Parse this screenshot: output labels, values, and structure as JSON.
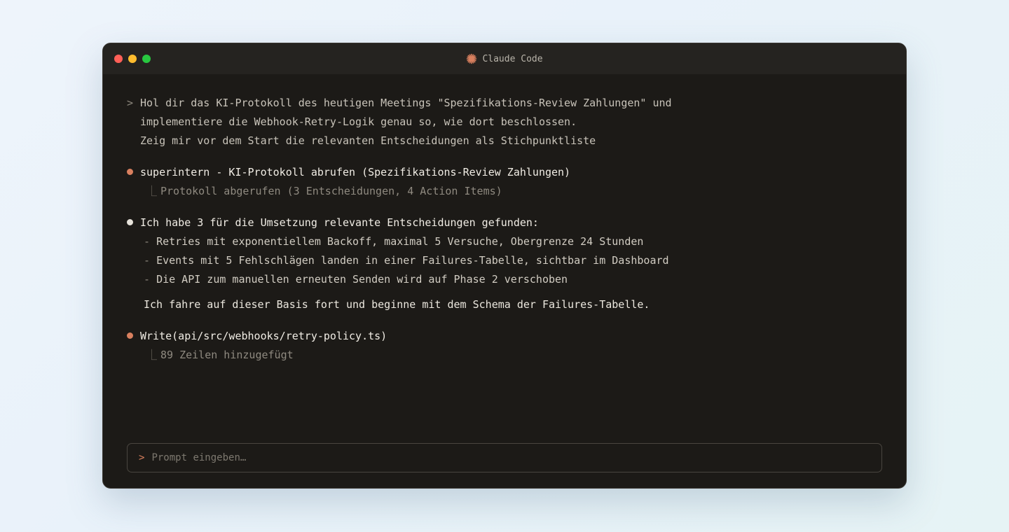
{
  "window": {
    "title": "Claude Code",
    "title_icon": "claude-asterisk-icon",
    "accent_color": "#d9805f"
  },
  "user_prompt": {
    "prefix": ">",
    "lines": [
      "Hol dir das KI-Protokoll des heutigen Meetings \"Spezifikations-Review Zahlungen\" und",
      "implementiere die Webhook-Retry-Logik genau so, wie dort beschlossen.",
      "Zeig mir vor dem Start die relevanten Entscheidungen als Stichpunktliste"
    ]
  },
  "tool_call_1": {
    "label": "superintern - KI-Protokoll abrufen (Spezifikations-Review Zahlungen)",
    "result": "Protokoll abgerufen (3 Entscheidungen, 4 Action Items)"
  },
  "assistant_message": {
    "intro": "Ich habe 3 für die Umsetzung relevante Entscheidungen gefunden:",
    "items": [
      "Retries mit exponentiellem Backoff, maximal 5 Versuche, Obergrenze 24 Stunden",
      "Events mit 5 Fehlschlägen landen in einer Failures-Tabelle, sichtbar im Dashboard",
      "Die API zum manuellen erneuten Senden wird auf Phase 2 verschoben"
    ],
    "summary": "Ich fahre auf dieser Basis fort und beginne mit dem Schema der Failures-Tabelle."
  },
  "tool_call_2": {
    "label": "Write(api/src/webhooks/retry-policy.ts)",
    "result": "89 Zeilen hinzugefügt"
  },
  "input": {
    "prefix": ">",
    "placeholder": "Prompt eingeben…",
    "value": ""
  }
}
